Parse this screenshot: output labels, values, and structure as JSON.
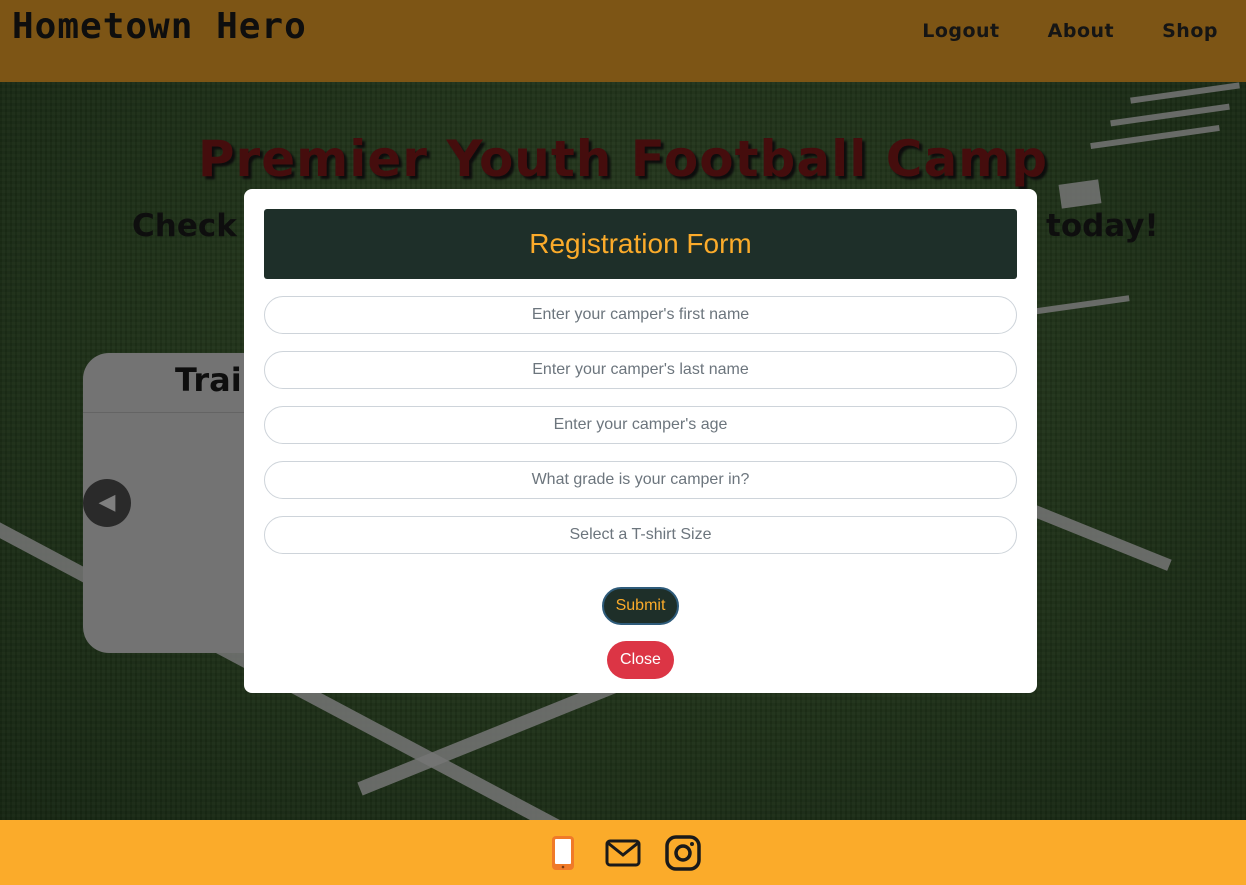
{
  "header": {
    "brand": "Hometown Hero",
    "nav": [
      {
        "label": "Logout"
      },
      {
        "label": "About"
      },
      {
        "label": "Shop"
      }
    ]
  },
  "hero": {
    "title": "Premier Youth Football Camp",
    "subtitle_left": "Check",
    "subtitle_right": "today!"
  },
  "card": {
    "title": "Trai"
  },
  "modal": {
    "title": "Registration Form",
    "fields": [
      {
        "placeholder": "Enter your camper's first name"
      },
      {
        "placeholder": "Enter your camper's last name"
      },
      {
        "placeholder": "Enter your camper's age"
      },
      {
        "placeholder": "What grade is your camper in?"
      },
      {
        "placeholder": "Select a T-shirt Size"
      }
    ],
    "submit_label": "Submit",
    "close_label": "Close"
  },
  "footer": {
    "icons": [
      "phone-icon",
      "mail-icon",
      "instagram-icon"
    ]
  },
  "colors": {
    "brand": "#fbab2a",
    "dark_green": "#1e2f29",
    "danger": "#dc3545",
    "title_red": "#8a1b1b"
  }
}
